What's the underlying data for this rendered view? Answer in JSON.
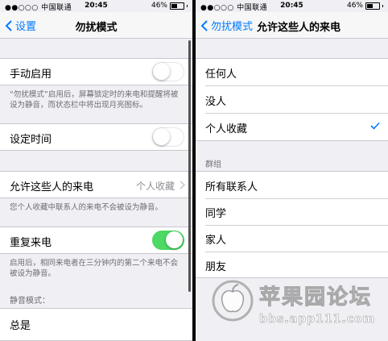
{
  "status_left": {
    "carrier": "●●○○○ 中国联通",
    "time": "20:45",
    "battery": "46%",
    "battery_level": 0.46
  },
  "status_right": {
    "carrier": "●●○○○ 中国联通",
    "time": "20:45",
    "battery": "46%",
    "battery_level": 0.46
  },
  "left": {
    "back_label": "设置",
    "title": "勿扰模式",
    "manual": {
      "label": "手动启用",
      "on": false
    },
    "manual_footer": "“勿扰模式”启用后，屏幕锁定时的来电和提醒将被设为静音，而状态栏中将出现月亮图标。",
    "scheduled": {
      "label": "设定时间",
      "on": false
    },
    "allow_calls": {
      "label": "允许这些人的来电",
      "value": "个人收藏"
    },
    "allow_footer": "您个人收藏中联系人的来电不会被设为静音。",
    "repeat": {
      "label": "重复来电",
      "on": true
    },
    "repeat_footer": "启用后，相同来电者在三分钟内的第二个来电不会被设为静音。",
    "silence_header": "静音模式：",
    "always_label": "总是"
  },
  "right": {
    "back_label": "勿扰模式",
    "title": "允许这些人的来电",
    "options": [
      {
        "label": "任何人",
        "selected": false
      },
      {
        "label": "没人",
        "selected": false
      },
      {
        "label": "个人收藏",
        "selected": true
      }
    ],
    "groups_header": "群组",
    "groups": [
      {
        "label": "所有联系人"
      },
      {
        "label": "同学"
      },
      {
        "label": "家人"
      },
      {
        "label": "朋友"
      }
    ]
  },
  "watermark": {
    "title": "苹果园论坛",
    "url": "bbs.app111.com"
  },
  "colors": {
    "accent": "#007aff",
    "toggle_on": "#4cd964",
    "background": "#efeff4"
  }
}
